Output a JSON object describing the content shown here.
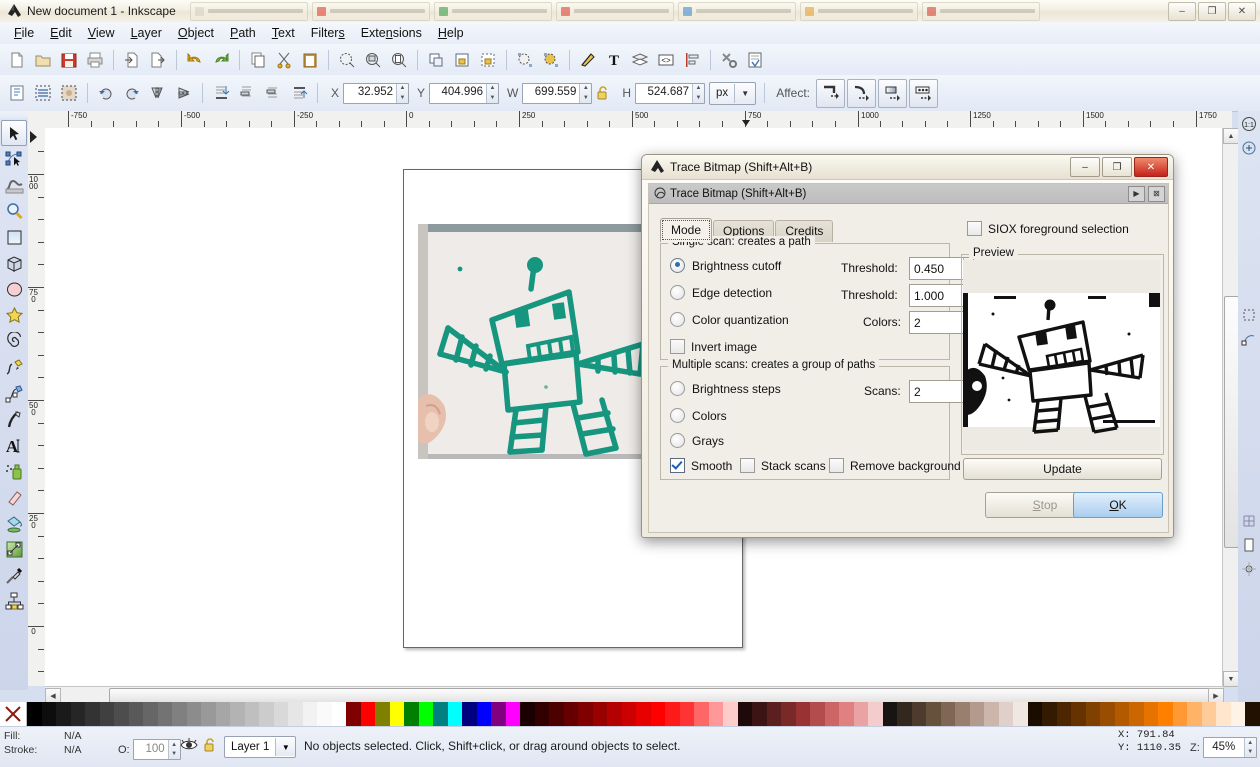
{
  "titlebar": {
    "title": "New document 1 - Inkscape",
    "app_icon": "inkscape-icon",
    "minimize": "–",
    "restore": "❐",
    "close": "✕",
    "taskbar_items": [
      {
        "name": "taskbar-item-1",
        "color": "#d8d3c9"
      },
      {
        "name": "taskbar-item-2",
        "color": "#e04a3a"
      },
      {
        "name": "taskbar-item-3",
        "color": "#3fa34d"
      },
      {
        "name": "taskbar-item-4",
        "color": "#e04a3a"
      },
      {
        "name": "taskbar-item-5",
        "color": "#4a90d9"
      },
      {
        "name": "taskbar-item-6",
        "color": "#e8a33d"
      },
      {
        "name": "taskbar-item-7",
        "color": "#d94b3a"
      }
    ]
  },
  "menubar": {
    "items": [
      {
        "label": "File",
        "accel": "F"
      },
      {
        "label": "Edit",
        "accel": "E"
      },
      {
        "label": "View",
        "accel": "V"
      },
      {
        "label": "Layer",
        "accel": "L"
      },
      {
        "label": "Object",
        "accel": "O"
      },
      {
        "label": "Path",
        "accel": "P"
      },
      {
        "label": "Text",
        "accel": "T"
      },
      {
        "label": "Filters",
        "accel": "s"
      },
      {
        "label": "Extensions",
        "accel": "n"
      },
      {
        "label": "Help",
        "accel": "H"
      }
    ]
  },
  "commandbar": {
    "buttons": [
      "new-document-icon",
      "open-document-icon",
      "save-document-icon",
      "print-icon",
      "import-icon",
      "export-icon",
      "undo-icon",
      "redo-icon",
      "copy-icon",
      "cut-icon",
      "paste-icon",
      "zoom-selection-icon",
      "zoom-drawing-icon",
      "zoom-page-icon",
      "duplicate-icon",
      "group-icon",
      "ungroup-icon",
      "fill-stroke-icon",
      "text-properties-icon",
      "xml-editor-icon",
      "align-distribute-icon",
      "preferences-icon",
      "document-properties-icon"
    ]
  },
  "selbar": {
    "icons": [
      "select-all-icon",
      "select-all-layers-icon",
      "deselect-icon",
      "rotate-ccw-icon",
      "rotate-cw-icon",
      "flip-horizontal-icon",
      "flip-vertical-icon",
      "lower-to-bottom-icon",
      "lower-icon",
      "raise-icon",
      "raise-to-top-icon"
    ],
    "x_label": "X",
    "x_value": "32.952",
    "y_label": "Y",
    "y_value": "404.996",
    "w_label": "W",
    "w_value": "699.559",
    "lock_icon": "lock-open-icon",
    "h_label": "H",
    "h_value": "524.687",
    "units_value": "px",
    "affect_label": "Affect:",
    "affect_buttons": [
      "scale-stroke-width-icon",
      "scale-rounded-corners-icon",
      "move-gradients-icon",
      "move-patterns-icon"
    ]
  },
  "toolbox": {
    "tools": [
      {
        "name": "selector-tool",
        "icon": "arrow-cursor-icon",
        "selected": true
      },
      {
        "name": "node-tool",
        "icon": "node-editor-icon",
        "selected": false
      },
      {
        "name": "tweak-tool",
        "icon": "tweak-icon",
        "selected": false
      },
      {
        "name": "zoom-tool",
        "icon": "magnifier-icon",
        "selected": false
      },
      {
        "name": "rectangle-tool",
        "icon": "rectangle-icon",
        "selected": false
      },
      {
        "name": "box3d-tool",
        "icon": "cube-3d-icon",
        "selected": false
      },
      {
        "name": "ellipse-tool",
        "icon": "ellipse-icon",
        "selected": false
      },
      {
        "name": "star-tool",
        "icon": "star-icon",
        "selected": false
      },
      {
        "name": "spiral-tool",
        "icon": "spiral-icon",
        "selected": false
      },
      {
        "name": "pencil-tool",
        "icon": "pencil-icon",
        "selected": false
      },
      {
        "name": "bezier-tool",
        "icon": "bezier-pen-icon",
        "selected": false
      },
      {
        "name": "calligraphy-tool",
        "icon": "calligraphy-pen-icon",
        "selected": false
      },
      {
        "name": "text-tool",
        "icon": "text-a-icon",
        "selected": false
      },
      {
        "name": "spray-tool",
        "icon": "spray-can-icon",
        "selected": false
      },
      {
        "name": "eraser-tool",
        "icon": "eraser-icon",
        "selected": false
      },
      {
        "name": "paint-bucket-tool",
        "icon": "paint-bucket-icon",
        "selected": false
      },
      {
        "name": "gradient-tool",
        "icon": "gradient-icon",
        "selected": false
      },
      {
        "name": "dropper-tool",
        "icon": "eyedropper-icon",
        "selected": false
      },
      {
        "name": "connector-tool",
        "icon": "connector-icon",
        "selected": false
      }
    ]
  },
  "rulers": {
    "horizontal_labels": [
      "-750",
      "-500",
      "-250",
      "0",
      "250",
      "500",
      "750",
      "1000",
      "1250",
      "1500",
      "1750"
    ],
    "vertical_labels": [
      "1000",
      "750",
      "500",
      "250",
      "0"
    ]
  },
  "canvas": {
    "page_name": "document-page",
    "image_name": "robot-drawing-photo",
    "image_description": "Photograph of a child's teal marker drawing of a robot on white paper held by a hand"
  },
  "dialog": {
    "window_title": "Trace Bitmap (Shift+Alt+B)",
    "window_icon": "inkscape-icon",
    "minimize": "–",
    "restore": "❐",
    "close": "✕",
    "panel_title": "Trace Bitmap (Shift+Alt+B)",
    "panel_icon": "trace-bitmap-icon",
    "panel_expand": "▶",
    "panel_close": "⊠",
    "tabs": [
      {
        "label": "Mode",
        "active": true
      },
      {
        "label": "Options",
        "active": false
      },
      {
        "label": "Credits",
        "active": false
      }
    ],
    "siox_label": "SIOX foreground selection",
    "siox_checked": false,
    "single_scan": {
      "legend": "Single scan: creates a path",
      "options": [
        {
          "name": "brightness-cutoff",
          "label": "Brightness cutoff",
          "selected": true,
          "field_label": "Threshold:",
          "field_value": "0.450"
        },
        {
          "name": "edge-detection",
          "label": "Edge detection",
          "selected": false,
          "field_label": "Threshold:",
          "field_value": "1.000"
        },
        {
          "name": "color-quantization",
          "label": "Color quantization",
          "selected": false,
          "field_label": "Colors:",
          "field_value": "2"
        }
      ],
      "invert_label": "Invert image",
      "invert_checked": false
    },
    "multiple_scans": {
      "legend": "Multiple scans: creates a group of paths",
      "options": [
        {
          "name": "brightness-steps",
          "label": "Brightness steps",
          "selected": false,
          "field_label": "Scans:",
          "field_value": "2"
        },
        {
          "name": "colors",
          "label": "Colors",
          "selected": false
        },
        {
          "name": "grays",
          "label": "Grays",
          "selected": false
        }
      ],
      "checkboxes": [
        {
          "name": "smooth",
          "label": "Smooth",
          "checked": true
        },
        {
          "name": "stack-scans",
          "label": "Stack scans",
          "checked": false
        },
        {
          "name": "remove-background",
          "label": "Remove background",
          "checked": false
        }
      ]
    },
    "preview_legend": "Preview",
    "preview_image": "traced-robot-bitmap-preview",
    "update_label": "Update",
    "stop_label": "Stop",
    "stop_enabled": false,
    "ok_label": "OK",
    "ok_accel": "O"
  },
  "statusbar": {
    "fill_label": "Fill:",
    "fill_value": "N/A",
    "stroke_label": "Stroke:",
    "stroke_value": "N/A",
    "opacity_label": "O:",
    "opacity_value": "100",
    "eye_icon": "visibility-eye-icon",
    "lock_icon": "layer-lock-icon",
    "layer_name": "Layer 1",
    "message": "No objects selected. Click, Shift+click, or drag around objects to select.",
    "cursor_x_label": "X:",
    "cursor_x": "791.84",
    "cursor_y_label": "Y:",
    "cursor_y": "1110.35",
    "zoom_label": "Z:",
    "zoom_value": "45%"
  },
  "palette": {
    "none_swatch": "none-color-x-icon",
    "colors": [
      "#000000",
      "#0d0d0d",
      "#1a1a1a",
      "#262626",
      "#333333",
      "#404040",
      "#4d4d4d",
      "#595959",
      "#666666",
      "#737373",
      "#808080",
      "#8c8c8c",
      "#999999",
      "#a6a6a6",
      "#b3b3b3",
      "#bfbfbf",
      "#cccccc",
      "#d9d9d9",
      "#e6e6e6",
      "#f2f2f2",
      "#fafafa",
      "#ffffff",
      "#800000",
      "#ff0000",
      "#808000",
      "#ffff00",
      "#008000",
      "#00ff00",
      "#008080",
      "#00ffff",
      "#000080",
      "#0000ff",
      "#800080",
      "#ff00ff",
      "#1a0000",
      "#330000",
      "#4d0000",
      "#660000",
      "#800000",
      "#990000",
      "#b30000",
      "#cc0000",
      "#e60000",
      "#ff0000",
      "#ff1a1a",
      "#ff3333",
      "#ff6666",
      "#ff9999",
      "#ffcccc",
      "#1f0a0a",
      "#3d1414",
      "#5c1f1f",
      "#7a2929",
      "#993333",
      "#b34d4d",
      "#cc6666",
      "#e08080",
      "#eaa3a3",
      "#f5cccc",
      "#191414",
      "#33281e",
      "#4d3c2d",
      "#66513c",
      "#806654",
      "#99806e",
      "#b39a8d",
      "#ccb5ab",
      "#e0d0c9",
      "#f0e6e2",
      "#1a0d00",
      "#331a00",
      "#4d2600",
      "#663300",
      "#804000",
      "#994d00",
      "#b35900",
      "#cc6600",
      "#e67300",
      "#ff8000",
      "#ff9933",
      "#ffb366",
      "#ffcc99",
      "#ffe6cc",
      "#fff2e6",
      "#221100"
    ]
  }
}
